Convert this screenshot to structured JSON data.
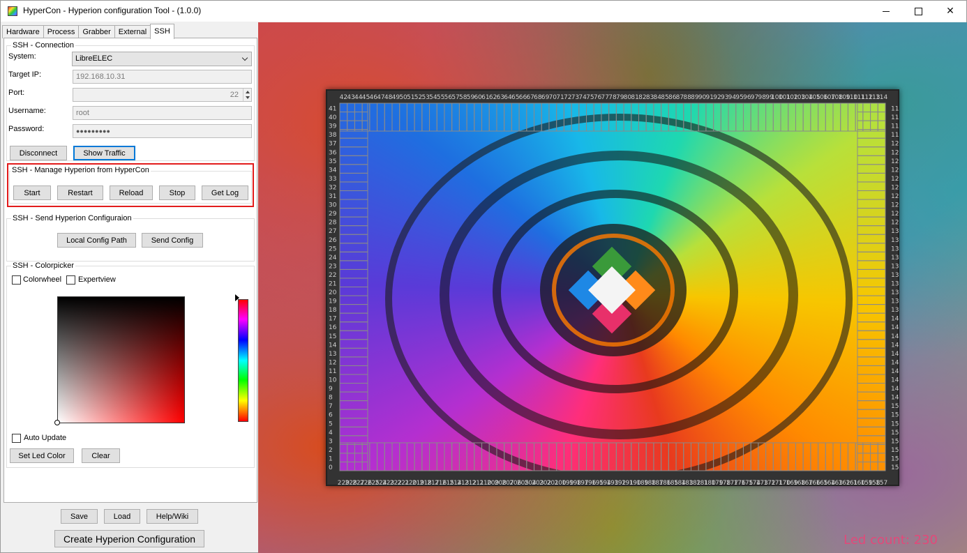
{
  "window": {
    "title": "HyperCon - Hyperion configuration Tool - (1.0.0)"
  },
  "tabs": [
    "Hardware",
    "Process",
    "Grabber",
    "External",
    "SSH"
  ],
  "active_tab": "SSH",
  "connection": {
    "group_title": "SSH - Connection",
    "system_label": "System:",
    "system_value": "LibreELEC",
    "target_ip_label": "Target IP:",
    "target_ip_value": "192.168.10.31",
    "port_label": "Port:",
    "port_value": "22",
    "username_label": "Username:",
    "username_value": "root",
    "password_label": "Password:",
    "password_value": "●●●●●●●●●",
    "disconnect_label": "Disconnect",
    "show_traffic_label": "Show Traffic"
  },
  "manage": {
    "group_title": "SSH - Manage Hyperion from HyperCon",
    "buttons": [
      "Start",
      "Restart",
      "Reload",
      "Stop",
      "Get Log"
    ]
  },
  "send_config": {
    "group_title": "SSH - Send Hyperion Configuraion",
    "local_config_label": "Local Config Path",
    "send_config_label": "Send Config"
  },
  "colorpicker": {
    "group_title": "SSH - Colorpicker",
    "colorwheel_label": "Colorwheel",
    "expertview_label": "Expertview",
    "auto_update_label": "Auto Update",
    "set_led_color_label": "Set Led Color",
    "clear_label": "Clear",
    "hue": "#ff0000",
    "colorwheel_checked": false,
    "expertview_checked": false,
    "auto_update_checked": false
  },
  "footer": {
    "save_label": "Save",
    "load_label": "Load",
    "help_label": "Help/Wiki",
    "create_label": "Create Hyperion Configuration"
  },
  "preview": {
    "led_count_text": "Led count: 230",
    "top_leds": [
      "42",
      "43",
      "44",
      "45",
      "46",
      "47",
      "48",
      "49",
      "50",
      "51",
      "52",
      "53",
      "54",
      "55",
      "56",
      "57",
      "58",
      "59",
      "60",
      "61",
      "62",
      "63",
      "64",
      "65",
      "66",
      "67",
      "68",
      "69",
      "70",
      "71",
      "72",
      "73",
      "74",
      "75",
      "76",
      "77",
      "78",
      "79",
      "80",
      "81",
      "82",
      "83",
      "84",
      "85",
      "86",
      "87",
      "88",
      "89",
      "90",
      "91",
      "92",
      "93",
      "94",
      "95",
      "96",
      "97",
      "98",
      "99",
      "100",
      "101",
      "102",
      "103",
      "104",
      "105",
      "106",
      "107",
      "108",
      "109",
      "110",
      "111",
      "112",
      "113",
      "114"
    ],
    "left_leds": [
      "41",
      "40",
      "39",
      "38",
      "37",
      "36",
      "35",
      "34",
      "33",
      "32",
      "31",
      "30",
      "29",
      "28",
      "27",
      "26",
      "25",
      "24",
      "23",
      "22",
      "21",
      "20",
      "19",
      "18",
      "17",
      "16",
      "15",
      "14",
      "13",
      "12",
      "11",
      "10",
      "9",
      "8",
      "7",
      "6",
      "5",
      "4",
      "3",
      "2",
      "1",
      "0"
    ],
    "right_leds": [
      "11",
      "11",
      "11",
      "11",
      "12",
      "12",
      "12",
      "12",
      "12",
      "12",
      "12",
      "12",
      "12",
      "12",
      "13",
      "13",
      "13",
      "13",
      "13",
      "13",
      "13",
      "13",
      "13",
      "13",
      "14",
      "14",
      "14",
      "14",
      "14",
      "14",
      "14",
      "14",
      "14",
      "14",
      "15",
      "15",
      "15",
      "15",
      "15",
      "15",
      "15",
      "15"
    ],
    "bottom_leds": [
      "229",
      "228",
      "227",
      "226",
      "225",
      "224",
      "223",
      "222",
      "221",
      "220",
      "219",
      "218",
      "217",
      "216",
      "215",
      "214",
      "213",
      "212",
      "211",
      "210",
      "209",
      "208",
      "207",
      "206",
      "205",
      "204",
      "203",
      "202",
      "201",
      "200",
      "199",
      "198",
      "197",
      "196",
      "195",
      "194",
      "193",
      "192",
      "191",
      "190",
      "189",
      "188",
      "187",
      "186",
      "185",
      "184",
      "183",
      "182",
      "181",
      "180",
      "179",
      "178",
      "177",
      "176",
      "175",
      "174",
      "173",
      "172",
      "171",
      "170",
      "169",
      "168",
      "167",
      "166",
      "165",
      "164",
      "163",
      "162",
      "161",
      "160",
      "159",
      "158",
      "157"
    ]
  }
}
